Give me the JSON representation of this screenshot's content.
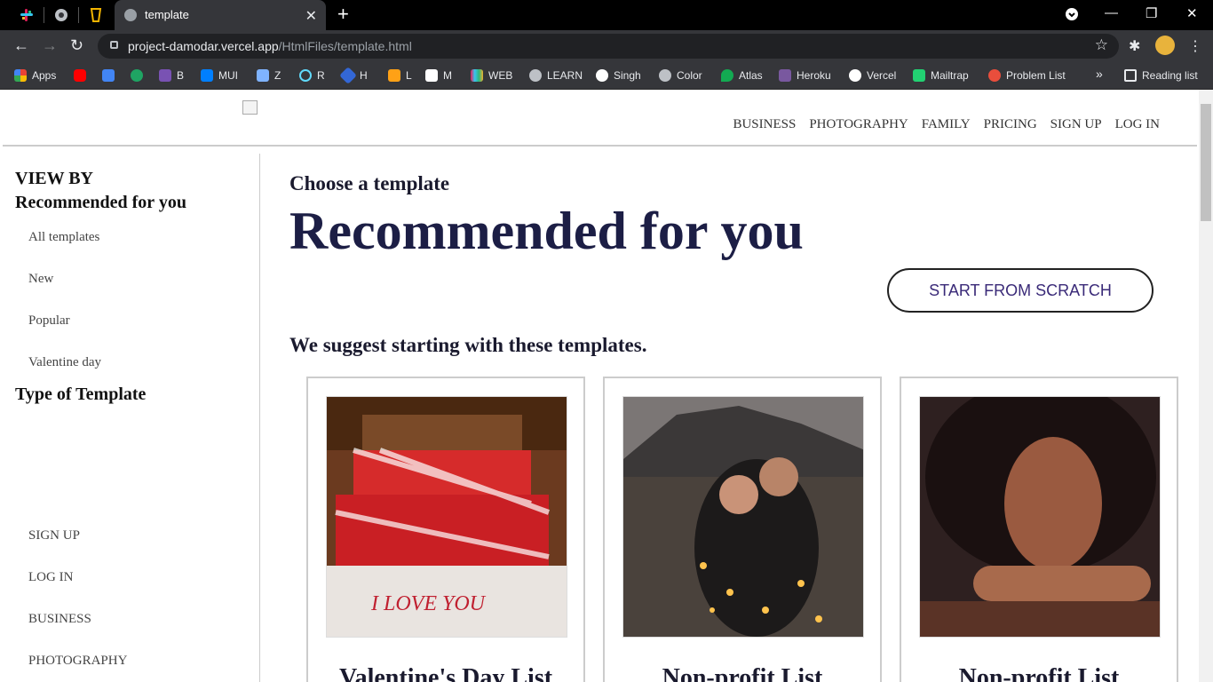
{
  "browser": {
    "tab_title": "template",
    "url_host": "project-damodar.vercel.app",
    "url_path": "/HtmlFiles/template.html",
    "bookmarks": [
      "Apps",
      "B",
      "MUI",
      "Z",
      "R",
      "H",
      "L",
      "M",
      "WEB",
      "LEARN",
      "Singh",
      "Color",
      "Atlas",
      "Heroku",
      "Vercel",
      "Mailtrap",
      "Problem List"
    ],
    "reading_list": "Reading list"
  },
  "nav": {
    "links": [
      "BUSINESS",
      "PHOTOGRAPHY",
      "FAMILY",
      "PRICING",
      "SIGN UP",
      "LOG IN"
    ]
  },
  "sidebar": {
    "view_by": "VIEW BY",
    "recommended": "Recommended for you",
    "filters": [
      "All templates",
      "New",
      "Popular",
      "Valentine day"
    ],
    "type_heading": "Type of Template",
    "links": [
      "SIGN UP",
      "LOG IN",
      "BUSINESS",
      "PHOTOGRAPHY"
    ]
  },
  "main": {
    "subheading": "Choose a template",
    "heading": "Recommended for you",
    "scratch_button": "START FROM SCRATCH",
    "suggest": "We suggest starting with these templates.",
    "cards": [
      {
        "title": "Valentine's Day List"
      },
      {
        "title": "Non-profit List"
      },
      {
        "title": "Non-profit List"
      }
    ]
  }
}
